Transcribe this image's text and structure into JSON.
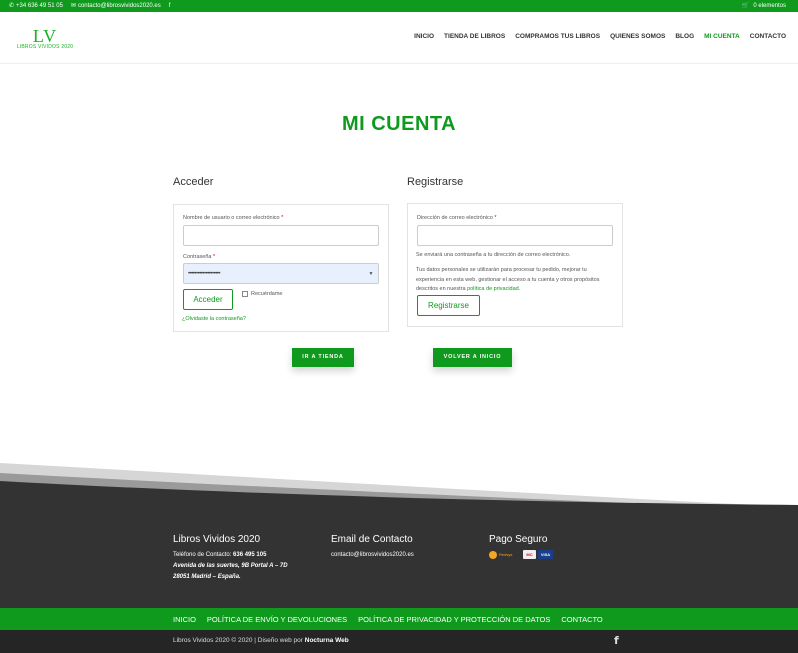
{
  "topbar": {
    "phone": "+34 636 49 51 05",
    "email": "contacto@librosvividos2020.es",
    "facebook_icon": "f",
    "cart": "0 elementos"
  },
  "header": {
    "logo_mark": "LV",
    "logo_sub": "LIBROS VIVIDOS 2020",
    "nav": [
      {
        "label": "INICIO"
      },
      {
        "label": "TIENDA DE LIBROS"
      },
      {
        "label": "COMPRAMOS TUS LIBROS"
      },
      {
        "label": "QUIENES SOMOS"
      },
      {
        "label": "BLOG"
      },
      {
        "label": "MI CUENTA"
      },
      {
        "label": "CONTACTO"
      }
    ]
  },
  "page": {
    "title": "MI CUENTA"
  },
  "login": {
    "heading": "Acceder",
    "username_label": "Nombre de usuario o correo electrónico",
    "required_mark": "*",
    "password_label": "Contraseña",
    "password_value": "••••••••••••••••••••",
    "submit": "Acceder",
    "remember": "Recuérdame",
    "lost_password": "¿Olvidaste la contraseña?"
  },
  "register": {
    "heading": "Registrarse",
    "email_label": "Dirección de correo electrónico",
    "password_note": "Se enviará una contraseña a tu dirección de correo electrónico.",
    "privacy_text": "Tus datos personales se utilizarán para procesar tu pedido, mejorar tu experiencia en esta web, gestionar el acceso a tu cuenta y otros propósitos descritos en nuestra",
    "privacy_link": "política de privacidad",
    "privacy_end": ".",
    "submit": "Registrarse"
  },
  "actions": {
    "shop": "IR A TIENDA",
    "home": "VOLVER A INICIO"
  },
  "footer": {
    "col1_title": "Libros Vividos 2020",
    "phone_label": "Teléfono de Contacto:",
    "phone_value": "636 495 105",
    "address1": "Avenida de las suertes, 9B Portal A – 7D",
    "address2": "28051 Madrid – España.",
    "col2_title": "Email de Contacto",
    "col2_email": "contacto@librosvividos2020.es",
    "col3_title": "Pago Seguro",
    "pay_brand": "Redsys",
    "pay_card1": "MC",
    "pay_card2": "VISA",
    "nav": [
      {
        "label": "INICIO"
      },
      {
        "label": "POLÍTICA DE ENVÍO Y DEVOLUCIONES"
      },
      {
        "label": "POLÍTICA DE PRIVACIDAD Y PROTECCIÓN DE DATOS"
      },
      {
        "label": "CONTACTO"
      }
    ],
    "copyright": "Libros Vividos 2020 © 2020 | Diseño web por",
    "designer": "Nocturna Web",
    "facebook_icon": "f"
  },
  "colors": {
    "brand_green": "#0f9a1e",
    "footer_dark": "#333333",
    "bottom_dark": "#252525"
  }
}
